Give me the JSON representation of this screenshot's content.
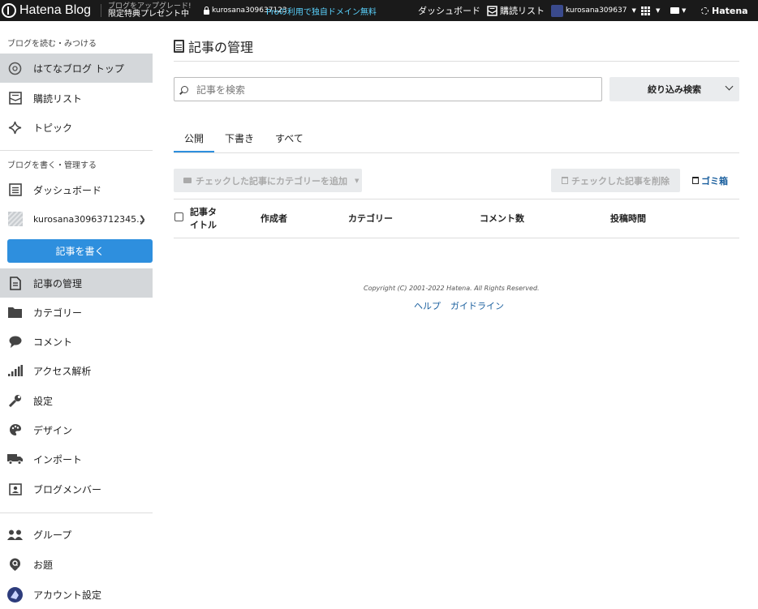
{
  "topbar": {
    "logo": "Hatena Blog",
    "upgrade_line1": "ブログをアップグレード!",
    "upgrade_line2": "限定特典プレゼント中",
    "blog_name": "kurosana309637123",
    "promo": "Proの利用で独自ドメイン無料",
    "dashboard": "ダッシュボード",
    "reading_list": "購読リスト",
    "username": "kurosana309637",
    "hatena": "Hatena"
  },
  "sidebar": {
    "section_read": "ブログを読む・みつける",
    "top": "はてなブログ トップ",
    "reading": "購読リスト",
    "topics": "トピック",
    "section_write": "ブログを書く・管理する",
    "dashboard": "ダッシュボード",
    "blog": "kurosana30963712345...",
    "write_button": "記事を書く",
    "manage": "記事の管理",
    "category": "カテゴリー",
    "comment": "コメント",
    "access": "アクセス解析",
    "settings": "設定",
    "design": "デザイン",
    "import": "インポート",
    "members": "ブログメンバー",
    "group": "グループ",
    "odai": "お題",
    "account": "アカウント設定"
  },
  "main": {
    "title": "記事の管理",
    "search_placeholder": "記事を検索",
    "filter_label": "絞り込み検索",
    "tabs": [
      "公開",
      "下書き",
      "すべて"
    ],
    "add_category": "チェックした記事にカテゴリーを追加",
    "delete_checked": "チェックした記事を削除",
    "trash": "ゴミ箱",
    "columns": [
      "記事タイトル",
      "作成者",
      "カテゴリー",
      "コメント数",
      "投稿時間"
    ],
    "copyright": "Copyright (C) 2001-2022 Hatena. All Rights Reserved.",
    "help": "ヘルプ",
    "guideline": "ガイドライン"
  },
  "colors": {
    "accent": "#2e8fde",
    "topbar": "#1a1a1a",
    "promo": "#5ad3ff",
    "active_nav": "#d4d7da"
  }
}
